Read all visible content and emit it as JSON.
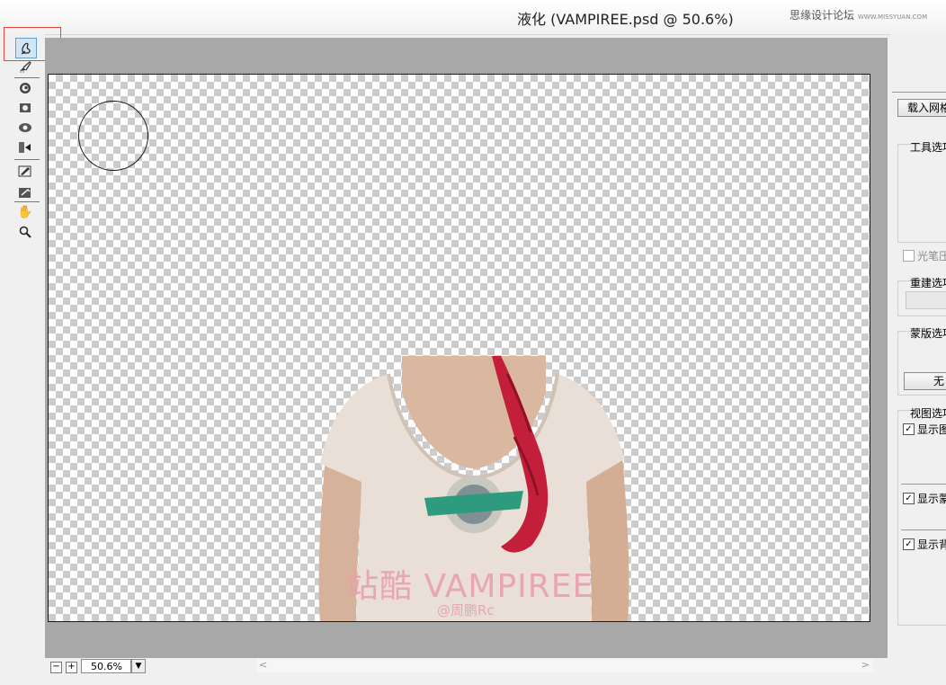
{
  "window": {
    "title": "液化 (VAMPIREE.psd @ 50.6%)",
    "watermark_text": "思缘设计论坛",
    "watermark_url": "WWW.MISSYUAN.COM"
  },
  "toolbar": {
    "tools": [
      {
        "name": "forward-warp-tool",
        "icon": "finger-brush-icon",
        "active": true
      },
      {
        "name": "reconstruct-tool",
        "icon": "brush-icon"
      },
      {
        "name": "twirl-tool",
        "icon": "swirl-icon"
      },
      {
        "name": "pucker-tool",
        "icon": "pucker-icon"
      },
      {
        "name": "bloat-tool",
        "icon": "bloat-icon"
      },
      {
        "name": "push-left-tool",
        "icon": "push-icon"
      },
      {
        "name": "freeze-mask-tool",
        "icon": "freeze-icon"
      },
      {
        "name": "thaw-mask-tool",
        "icon": "thaw-icon"
      },
      {
        "name": "hand-tool",
        "icon": "hand-icon"
      },
      {
        "name": "zoom-tool",
        "icon": "magnifier-icon"
      }
    ]
  },
  "canvas": {
    "watermark_main": "站酷 VAMPIREE",
    "watermark_sub": "@周鹏Rc"
  },
  "panel": {
    "load_mesh_label": "载入网格",
    "tool_options_label": "工具选项",
    "stylus_pressure_label": "光笔压力",
    "reconstruct_options_label": "重建选项",
    "mask_options_label": "蒙版选项",
    "mask_none_label": "无",
    "view_options_label": "视图选项",
    "show_image_label": "显示图像",
    "show_mask_label": "显示蒙版",
    "show_backdrop_label": "显示背景"
  },
  "zoom": {
    "value": "50.6%",
    "minus": "−",
    "plus": "+"
  },
  "colors": {
    "highlight": "#e5463f",
    "preview_bg": "#a8a8a8",
    "active_tool_bg": "#cfe6f7"
  }
}
